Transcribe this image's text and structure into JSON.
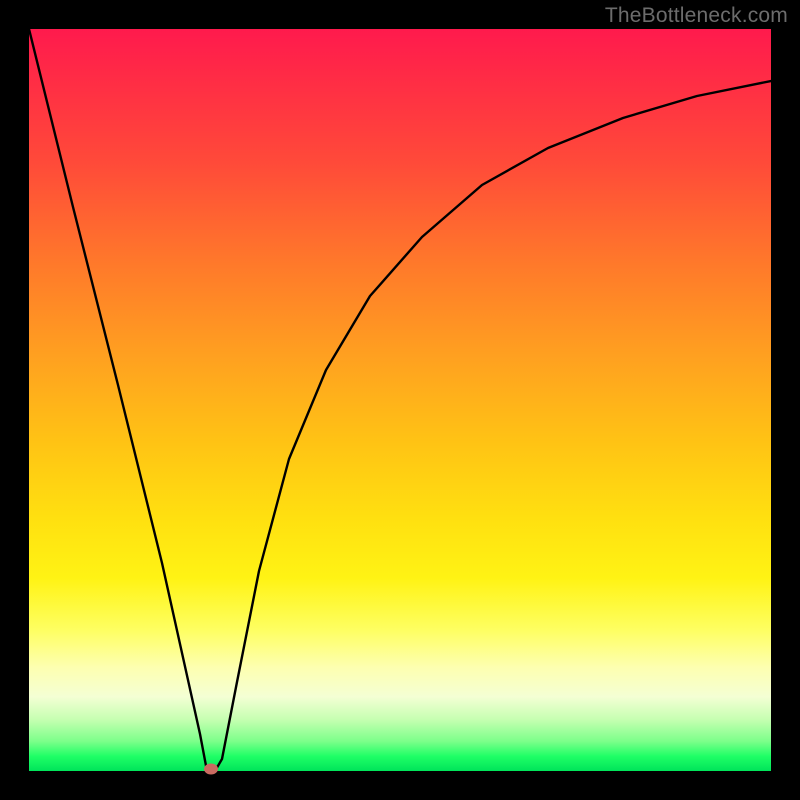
{
  "watermark": "TheBottleneck.com",
  "chart_data": {
    "type": "line",
    "title": "",
    "xlabel": "",
    "ylabel": "",
    "xlim": [
      0,
      100
    ],
    "ylim": [
      0,
      100
    ],
    "grid": false,
    "legend": false,
    "series": [
      {
        "name": "curve",
        "x": [
          0,
          6,
          12,
          18,
          23,
          24,
          25,
          26,
          28,
          31,
          35,
          40,
          46,
          53,
          61,
          70,
          80,
          90,
          100
        ],
        "y": [
          100,
          76,
          52,
          28,
          5,
          0,
          0,
          2,
          12,
          27,
          42,
          54,
          64,
          72,
          79,
          84,
          88,
          91,
          93
        ]
      }
    ],
    "marker": {
      "x": 24.5,
      "y": 0
    },
    "background_gradient": {
      "stops": [
        {
          "pos": 0,
          "color": "#ff1a4d"
        },
        {
          "pos": 32,
          "color": "#ff7a2a"
        },
        {
          "pos": 66,
          "color": "#ffe010"
        },
        {
          "pos": 86,
          "color": "#fdffb0"
        },
        {
          "pos": 100,
          "color": "#00e45a"
        }
      ]
    }
  }
}
